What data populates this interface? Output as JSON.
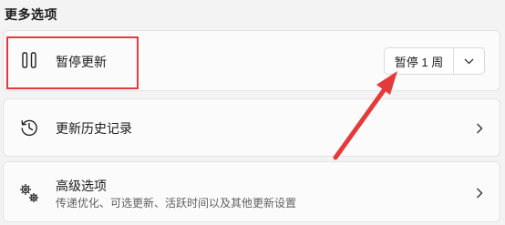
{
  "section": {
    "title": "更多选项"
  },
  "pause": {
    "label": "暂停更新",
    "button_label": "暂停 1 周",
    "icon": "pause-icon"
  },
  "history": {
    "label": "更新历史记录",
    "icon": "history-icon"
  },
  "advanced": {
    "label": "高级选项",
    "description": "传递优化、可选更新、活跃时间以及其他更新设置",
    "icon": "gears-icon"
  },
  "colors": {
    "annotation": "#e53a3a",
    "card_background": "#fbfbfb",
    "page_background": "#f3f3f3"
  }
}
